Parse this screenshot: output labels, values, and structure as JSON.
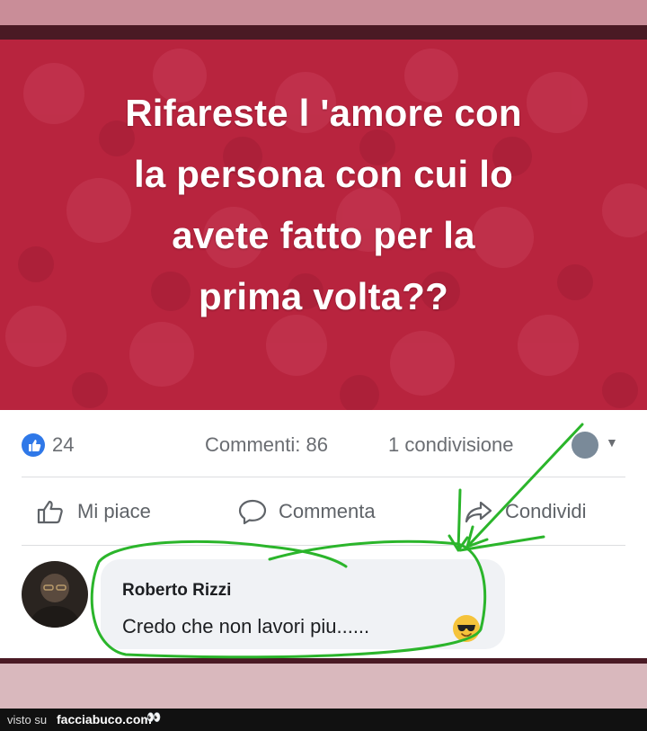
{
  "post": {
    "title_lines": [
      "Rifareste l 'amore con",
      "la persona con cui lo",
      "avete fatto per la",
      "prima volta??"
    ]
  },
  "stats": {
    "likes": "24",
    "comments": "Commenti: 86",
    "shares": "1 condivisione"
  },
  "actions": {
    "like": "Mi piace",
    "comment": "Commenta",
    "share": "Condividi"
  },
  "comment": {
    "author": "Roberto Rizzi",
    "text": "Credo che non lavori piu......"
  },
  "footer": {
    "prefix": "visto su",
    "site": "facciabuco.com",
    "eyes": "👀"
  },
  "colors": {
    "post_background": "#b8243e",
    "like_blue": "#2f78e8",
    "annotation_green": "#2bb52b"
  },
  "icons": [
    "like-badge-icon",
    "thumbs-up-icon",
    "comment-bubble-icon",
    "share-arrow-icon",
    "caret-down-icon",
    "sunglasses-emoji-icon"
  ]
}
